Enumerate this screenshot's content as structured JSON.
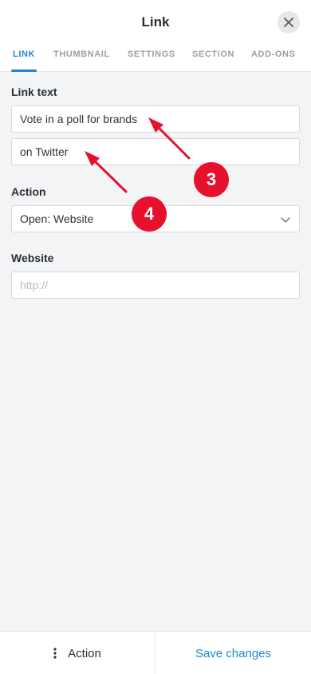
{
  "header": {
    "title": "Link"
  },
  "tabs": [
    {
      "label": "LINK",
      "active": true
    },
    {
      "label": "THUMBNAIL"
    },
    {
      "label": "SETTINGS"
    },
    {
      "label": "SECTION"
    },
    {
      "label": "ADD-ONS"
    }
  ],
  "form": {
    "link_text_label": "Link text",
    "link_text_line1": "Vote in a poll for brands",
    "link_text_line2": "on Twitter",
    "action_label": "Action",
    "action_value": "Open: Website",
    "website_label": "Website",
    "website_placeholder": "http://"
  },
  "annotations": {
    "badge_a": "3",
    "badge_b": "4"
  },
  "footer": {
    "action_label": "Action",
    "save_label": "Save changes"
  },
  "colors": {
    "accent": "#1e88c9",
    "badge": "#e8112d",
    "background": "#f3f4f6"
  },
  "icons": {
    "close": "close-icon",
    "dropdown": "chevron-down-icon",
    "menu": "kebab-menu-icon"
  }
}
